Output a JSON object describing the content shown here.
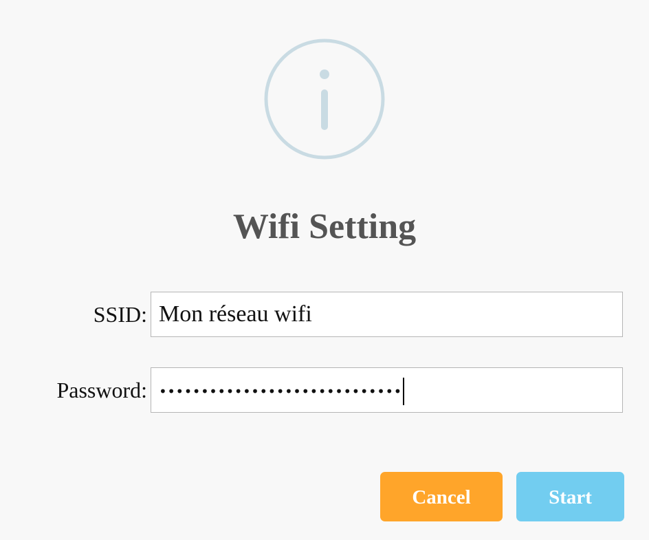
{
  "dialog": {
    "icon": "info-icon",
    "title": "Wifi Setting",
    "ssid": {
      "label": "SSID:",
      "value": "Mon réseau wifi"
    },
    "password": {
      "label": "Password:",
      "masked_value": "•••••••••••••••••••••••••••••"
    },
    "buttons": {
      "cancel_label": "Cancel",
      "start_label": "Start"
    },
    "colors": {
      "background": "#f8f8f8",
      "icon": "#c9dbe3",
      "title": "#545454",
      "cancel": "#ffa52a",
      "start": "#72cdf0"
    }
  }
}
